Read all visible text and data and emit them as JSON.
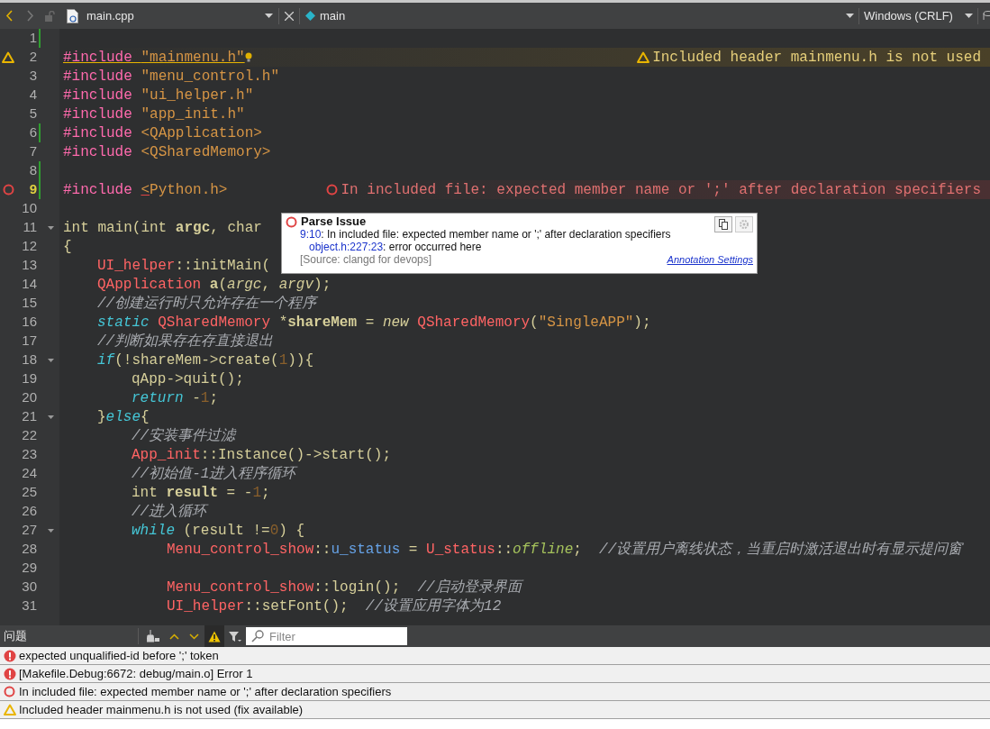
{
  "toolbar": {
    "file_name": "main.cpp",
    "symbol": "main",
    "line_ending": "Windows (CRLF)"
  },
  "editor": {
    "lines": [
      {
        "number": "1",
        "changed": true
      },
      {
        "number": "2",
        "warning": true,
        "quick_fix": true,
        "annotation": {
          "kind": "warning",
          "text": "Included header mainmenu.h is not used"
        },
        "tokens": [
          {
            "kind": "kw",
            "text": "#include ",
            "underlined": true
          },
          {
            "kind": "str",
            "text": "\"mainmenu.h\"",
            "underlined": true
          }
        ]
      },
      {
        "number": "3",
        "tokens": [
          {
            "kind": "kw",
            "text": "#include "
          },
          {
            "kind": "str",
            "text": "\"menu_control.h\""
          }
        ]
      },
      {
        "number": "4",
        "tokens": [
          {
            "kind": "kw",
            "text": "#include "
          },
          {
            "kind": "str",
            "text": "\"ui_helper.h\""
          }
        ]
      },
      {
        "number": "5",
        "tokens": [
          {
            "kind": "kw",
            "text": "#include "
          },
          {
            "kind": "str",
            "text": "\"app_init.h\""
          }
        ]
      },
      {
        "number": "6",
        "changed": true,
        "tokens": [
          {
            "kind": "kw",
            "text": "#include "
          },
          {
            "kind": "str",
            "text": "<QApplication>"
          }
        ]
      },
      {
        "number": "7",
        "tokens": [
          {
            "kind": "kw",
            "text": "#include "
          },
          {
            "kind": "str",
            "text": "<QSharedMemory>"
          }
        ]
      },
      {
        "number": "8",
        "changed": true
      },
      {
        "number": "9",
        "changed": true,
        "current": true,
        "error": true,
        "annotation": {
          "kind": "error",
          "text": "In included file: expected member name or ';' after declaration specifiers"
        },
        "tokens": [
          {
            "kind": "kw",
            "text": "#include "
          },
          {
            "kind": "str",
            "text": "<",
            "underlined": true
          },
          {
            "kind": "str",
            "text": "Python.h>"
          }
        ]
      },
      {
        "number": "10"
      },
      {
        "number": "11",
        "foldable": true,
        "tokens": [
          {
            "kind": "plain",
            "text": "int main(int "
          },
          {
            "kind": "bold",
            "text": "argc"
          },
          {
            "kind": "plain",
            "text": ", char"
          }
        ]
      },
      {
        "number": "12",
        "tokens": [
          {
            "kind": "plain",
            "text": "{"
          }
        ],
        "children": [
          {
            "number": "13",
            "tokens": [
              {
                "kind": "type",
                "text": "UI_helper"
              },
              {
                "kind": "plain",
                "text": "::initMain("
              }
            ]
          },
          {
            "number": "14",
            "tokens": [
              {
                "kind": "type",
                "text": "QApplication "
              },
              {
                "kind": "bold",
                "text": "a"
              },
              {
                "kind": "plain",
                "text": "("
              },
              {
                "kind": "param",
                "text": "argc"
              },
              {
                "kind": "plain",
                "text": ", "
              },
              {
                "kind": "param",
                "text": "argv"
              },
              {
                "kind": "plain",
                "text": ");"
              }
            ]
          },
          {
            "number": "15",
            "tokens": [
              {
                "kind": "comment",
                "text": "//创建运行时只允许存在一个程序"
              }
            ]
          },
          {
            "number": "16",
            "tokens": [
              {
                "kind": "ctrl",
                "text": "static "
              },
              {
                "kind": "type",
                "text": "QSharedMemory"
              },
              {
                "kind": "plain",
                "text": " *"
              },
              {
                "kind": "bold",
                "text": "shareMem"
              },
              {
                "kind": "plain",
                "text": " = "
              },
              {
                "kind": "newkw",
                "text": "new "
              },
              {
                "kind": "type",
                "text": "QSharedMemory"
              },
              {
                "kind": "plain",
                "text": "("
              },
              {
                "kind": "str",
                "text": "\"SingleAPP\""
              },
              {
                "kind": "plain",
                "text": ");"
              }
            ]
          },
          {
            "number": "17",
            "tokens": [
              {
                "kind": "comment",
                "text": "//判断如果存在存直接退出"
              }
            ]
          },
          {
            "number": "18",
            "foldable": true,
            "tokens": [
              {
                "kind": "ctrl",
                "text": "if"
              },
              {
                "kind": "plain",
                "text": "(!shareMem->create("
              },
              {
                "kind": "num",
                "text": "1"
              },
              {
                "kind": "plain",
                "text": ")){"
              }
            ],
            "children": [
              {
                "number": "19",
                "tokens": [
                  {
                    "kind": "plain",
                    "text": "qApp->quit();"
                  }
                ]
              },
              {
                "number": "20",
                "tokens": [
                  {
                    "kind": "ctrl",
                    "text": "return"
                  },
                  {
                    "kind": "plain",
                    "text": " -"
                  },
                  {
                    "kind": "num",
                    "text": "1"
                  },
                  {
                    "kind": "plain",
                    "text": ";"
                  }
                ]
              }
            ]
          },
          {
            "number": "21",
            "foldable": true,
            "tokens": [
              {
                "kind": "plain",
                "text": "}"
              },
              {
                "kind": "ctrl",
                "text": "else"
              },
              {
                "kind": "plain",
                "text": "{"
              }
            ],
            "children": [
              {
                "number": "22",
                "tokens": [
                  {
                    "kind": "comment",
                    "text": "//安装事件过滤"
                  }
                ]
              },
              {
                "number": "23",
                "tokens": [
                  {
                    "kind": "type",
                    "text": "App_init"
                  },
                  {
                    "kind": "plain",
                    "text": "::Instance()->start();"
                  }
                ]
              },
              {
                "number": "24",
                "tokens": [
                  {
                    "kind": "comment",
                    "text": "//初始值-1进入程序循环"
                  }
                ]
              },
              {
                "number": "25",
                "tokens": [
                  {
                    "kind": "plain",
                    "text": "int "
                  },
                  {
                    "kind": "bold",
                    "text": "result"
                  },
                  {
                    "kind": "plain",
                    "text": " = -"
                  },
                  {
                    "kind": "num",
                    "text": "1"
                  },
                  {
                    "kind": "plain",
                    "text": ";"
                  }
                ]
              },
              {
                "number": "26",
                "tokens": [
                  {
                    "kind": "comment",
                    "text": "//进入循环"
                  }
                ]
              },
              {
                "number": "27",
                "foldable": true,
                "tokens": [
                  {
                    "kind": "ctrl",
                    "text": "while"
                  },
                  {
                    "kind": "plain",
                    "text": " (result !="
                  },
                  {
                    "kind": "num",
                    "text": "0"
                  },
                  {
                    "kind": "plain",
                    "text": ") {"
                  }
                ],
                "children": [
                  {
                    "number": "28",
                    "tokens": [
                      {
                        "kind": "type",
                        "text": "Menu_control_show"
                      },
                      {
                        "kind": "plain",
                        "text": "::"
                      },
                      {
                        "kind": "field",
                        "text": "u_status"
                      },
                      {
                        "kind": "plain",
                        "text": " = "
                      },
                      {
                        "kind": "type",
                        "text": "U_status"
                      },
                      {
                        "kind": "plain",
                        "text": "::"
                      },
                      {
                        "kind": "enum",
                        "text": "offline"
                      },
                      {
                        "kind": "plain",
                        "text": ";  "
                      },
                      {
                        "kind": "comment",
                        "text": "//设置用户离线状态，当重启时激活退出时有显示提问窗"
                      }
                    ]
                  },
                  {
                    "number": "29"
                  },
                  {
                    "number": "30",
                    "tokens": [
                      {
                        "kind": "type",
                        "text": "Menu_control_show"
                      },
                      {
                        "kind": "plain",
                        "text": "::login();  "
                      },
                      {
                        "kind": "comment",
                        "text": "//启动登录界面"
                      }
                    ]
                  },
                  {
                    "number": "31",
                    "tokens": [
                      {
                        "kind": "type",
                        "text": "UI_helper"
                      },
                      {
                        "kind": "plain",
                        "text": "::setFont();  "
                      },
                      {
                        "kind": "comment",
                        "text": "//设置应用字体为12"
                      }
                    ]
                  }
                ]
              }
            ]
          }
        ]
      }
    ]
  },
  "tooltip": {
    "title": "Parse Issue",
    "location": "9:10",
    "message": ": In included file: expected member name or ';' after declaration specifiers",
    "reference": "object.h:227:23",
    "reference_message": ": error occurred here",
    "source": "[Source: clangd for devops]",
    "settings_link": "Annotation Settings"
  },
  "issues_panel": {
    "title": "问题",
    "warnings_filter_on": true,
    "filter_placeholder": "Filter",
    "issues": [
      {
        "kind": "error",
        "text": "expected unqualified-id before ';' token"
      },
      {
        "kind": "error",
        "text": "[Makefile.Debug:6672: debug/main.o] Error 1"
      },
      {
        "kind": "error_outline",
        "text": "In included file: expected member name or ';' after declaration specifiers"
      },
      {
        "kind": "warning",
        "text": "Included header mainmenu.h is not used (fix available)"
      }
    ]
  }
}
